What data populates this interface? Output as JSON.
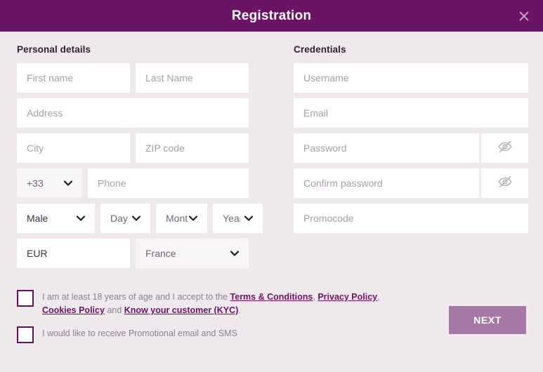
{
  "header": {
    "title": "Registration",
    "close_icon": "close-icon"
  },
  "personal": {
    "section_title": "Personal details",
    "first_name_placeholder": "First name",
    "last_name_placeholder": "Last Name",
    "address_placeholder": "Address",
    "city_placeholder": "City",
    "zip_placeholder": "ZIP code",
    "phone_code_value": "+33",
    "phone_placeholder": "Phone",
    "gender_value": "Male",
    "day_value": "Day",
    "month_value": "Month",
    "year_value": "Year",
    "currency_value": "EUR",
    "country_value": "France"
  },
  "credentials": {
    "section_title": "Credentials",
    "username_placeholder": "Username",
    "email_placeholder": "Email",
    "password_placeholder": "Password",
    "confirm_password_placeholder": "Confirm password",
    "promocode_placeholder": "Promocode",
    "toggle_icon": "eye-off-icon"
  },
  "consent": {
    "age_terms_prefix": "I am at least 18 years of age and I accept to the ",
    "terms_link": "Terms & Conditions",
    "sep_comma": ", ",
    "privacy_link": "Privacy Policy",
    "cookies_link": "Cookies Policy",
    "sep_and": " and ",
    "kyc_link": "Know your customer (KYC)",
    "sep_period": ".",
    "promotional_label": "I would like to receive Promotional email and SMS"
  },
  "actions": {
    "next_label": "NEXT"
  },
  "colors": {
    "header_bg": "#6b1464",
    "page_bg": "#efe9ee",
    "field_bg": "#ffffff",
    "field_shaded_bg": "#f8f5f7",
    "placeholder": "#a79daa",
    "link": "#6b1464",
    "next_bg": "#a878a4",
    "checkbox_border": "#5e1258"
  }
}
